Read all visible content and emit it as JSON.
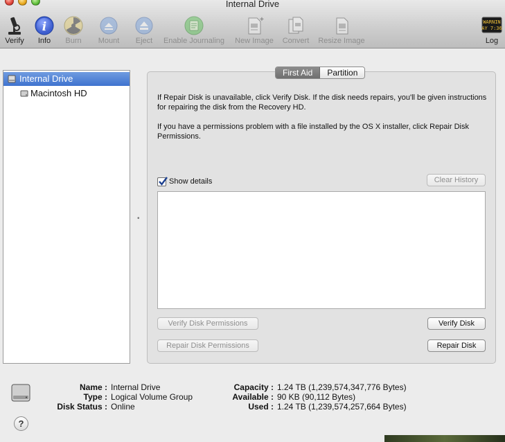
{
  "window": {
    "title": "Internal Drive"
  },
  "toolbar": {
    "verify": "Verify",
    "info": "Info",
    "burn": "Burn",
    "mount": "Mount",
    "eject": "Eject",
    "enable_journaling": "Enable Journaling",
    "new_image": "New Image",
    "convert": "Convert",
    "resize_image": "Resize Image",
    "log": "Log",
    "log_icon_line1": "WARNIN",
    "log_icon_line2": "AY 7:36"
  },
  "sidebar": {
    "items": [
      {
        "label": "Internal Drive",
        "selected": true
      },
      {
        "label": "Macintosh HD",
        "selected": false
      }
    ]
  },
  "tabs": [
    "First Aid",
    "Partition"
  ],
  "first_aid": {
    "paragraph1": "If Repair Disk is unavailable, click Verify Disk. If the disk needs repairs, you'll be given instructions for repairing the disk from the Recovery HD.",
    "paragraph2": "If you have a permissions problem with a file installed by the OS X installer, click Repair Disk Permissions.",
    "show_details_label": "Show details",
    "show_details_checked": true,
    "clear_history": "Clear History",
    "verify_disk_permissions": "Verify Disk Permissions",
    "repair_disk_permissions": "Repair Disk Permissions",
    "verify_disk": "Verify Disk",
    "repair_disk": "Repair Disk"
  },
  "info": {
    "name_key": "Name :",
    "name_value": "Internal Drive",
    "type_key": "Type :",
    "type_value": "Logical Volume Group",
    "status_key": "Disk Status :",
    "status_value": "Online",
    "capacity_key": "Capacity :",
    "capacity_value": "1.24 TB (1,239,574,347,776 Bytes)",
    "available_key": "Available :",
    "available_value": "90 KB (90,112 Bytes)",
    "used_key": "Used :",
    "used_value": "1.24 TB (1,239,574,257,664 Bytes)",
    "help": "?"
  },
  "colors": {
    "selection": "#3f73cf",
    "tab_active": "#7a7a7a",
    "info_icon": "#3c5fd0"
  }
}
